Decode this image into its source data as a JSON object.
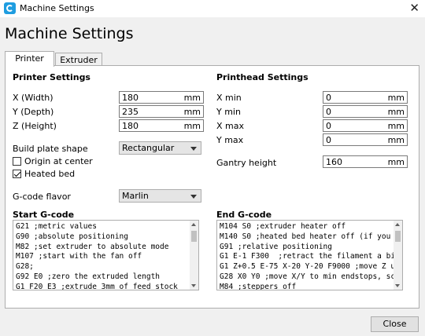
{
  "window": {
    "title": "Machine Settings"
  },
  "heading": "Machine Settings",
  "tabs": [
    {
      "label": "Printer",
      "active": true
    },
    {
      "label": "Extruder",
      "active": false
    }
  ],
  "printer_settings": {
    "title": "Printer Settings",
    "width": {
      "label": "X (Width)",
      "value": "180",
      "unit": "mm"
    },
    "depth": {
      "label": "Y (Depth)",
      "value": "235",
      "unit": "mm"
    },
    "height": {
      "label": "Z (Height)",
      "value": "180",
      "unit": "mm"
    },
    "build_plate": {
      "label": "Build plate shape",
      "value": "Rectangular"
    },
    "origin_center": {
      "label": "Origin at center",
      "checked": false
    },
    "heated_bed": {
      "label": "Heated bed",
      "checked": true
    },
    "gcode_flavor": {
      "label": "G-code flavor",
      "value": "Marlin"
    }
  },
  "printhead_settings": {
    "title": "Printhead Settings",
    "x_min": {
      "label": "X min",
      "value": "0",
      "unit": "mm"
    },
    "y_min": {
      "label": "Y min",
      "value": "0",
      "unit": "mm"
    },
    "x_max": {
      "label": "X max",
      "value": "0",
      "unit": "mm"
    },
    "y_max": {
      "label": "Y max",
      "value": "0",
      "unit": "mm"
    },
    "gantry": {
      "label": "Gantry height",
      "value": "160",
      "unit": "mm"
    }
  },
  "start_gcode": {
    "title": "Start G-code",
    "lines": [
      "G21 ;metric values",
      "G90 ;absolute positioning",
      "M82 ;set extruder to absolute mode",
      "M107 ;start with the fan off",
      "G28;",
      "G92 E0 ;zero the extruded length",
      "G1 F20 E3 ;extrude 3mm of feed stock"
    ]
  },
  "end_gcode": {
    "title": "End G-code",
    "lines": [
      "M104 S0 ;extruder heater off",
      "M140 S0 ;heated bed heater off (if you",
      "G91 ;relative positioning",
      "G1 E-1 F300  ;retract the filament a bi",
      "G1 Z+0.5 E-75 X-20 Y-20 F9000 ;move Z u",
      "G28 X0 Y0 ;move X/Y to min endstops, sc",
      "M84 ;steppers off"
    ]
  },
  "footer": {
    "close_label": "Close"
  },
  "icons": {
    "app": "cura-app-icon",
    "close": "close-icon"
  },
  "colors": {
    "accent": "#1f9de0"
  }
}
